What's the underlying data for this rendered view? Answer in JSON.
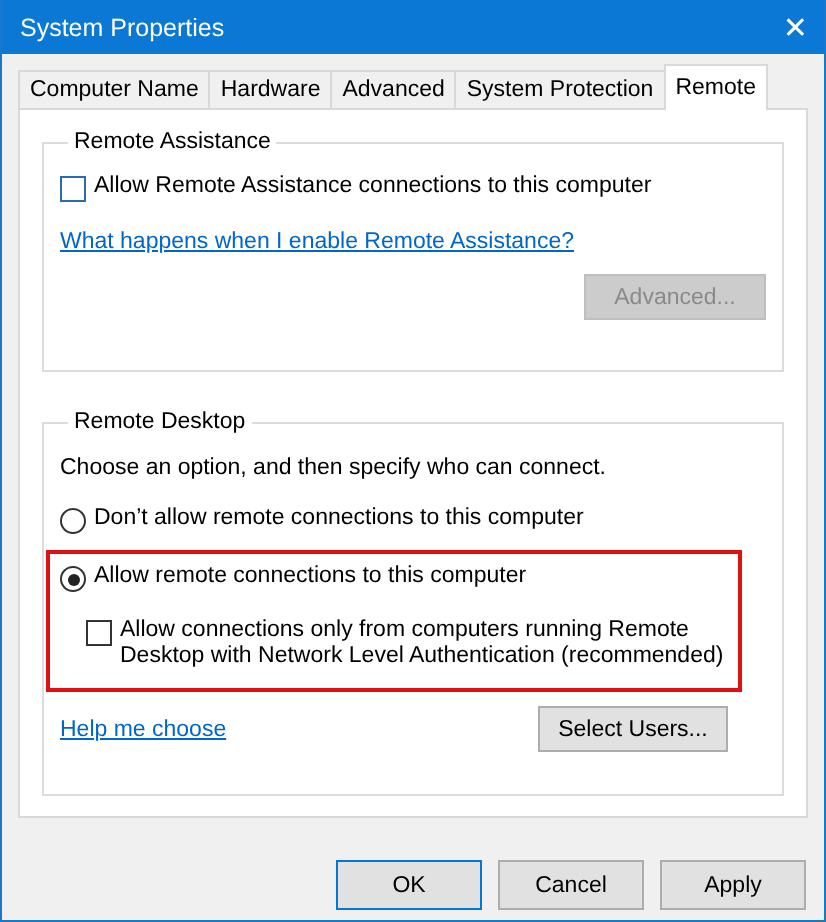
{
  "window": {
    "title": "System Properties",
    "close": "✕"
  },
  "tabs": [
    {
      "label": "Computer Name",
      "selected": false
    },
    {
      "label": "Hardware",
      "selected": false
    },
    {
      "label": "Advanced",
      "selected": false
    },
    {
      "label": "System Protection",
      "selected": false
    },
    {
      "label": "Remote",
      "selected": true
    }
  ],
  "remote_assistance": {
    "title": "Remote Assistance",
    "checkbox": {
      "label": "Allow Remote Assistance connections to this computer",
      "checked": false
    },
    "link": "What happens when I enable Remote Assistance?",
    "button": {
      "label": "Advanced...",
      "disabled": true
    }
  },
  "remote_desktop": {
    "title": "Remote Desktop",
    "intro": "Choose an option, and then specify who can connect.",
    "options": [
      {
        "label": "Don’t allow remote connections to this computer",
        "selected": false,
        "highlighted": false
      },
      {
        "label": "Allow remote connections to this computer",
        "selected": true,
        "highlighted": true,
        "sub_checkbox": {
          "label": "Allow connections only from computers running Remote Desktop with Network Level Authentication (recommended)",
          "checked": false
        }
      }
    ],
    "link": "Help me choose",
    "button": {
      "label": "Select Users...",
      "disabled": false
    }
  },
  "buttons": [
    {
      "label": "OK",
      "default": true
    },
    {
      "label": "Cancel",
      "default": false
    },
    {
      "label": "Apply",
      "default": false
    }
  ]
}
